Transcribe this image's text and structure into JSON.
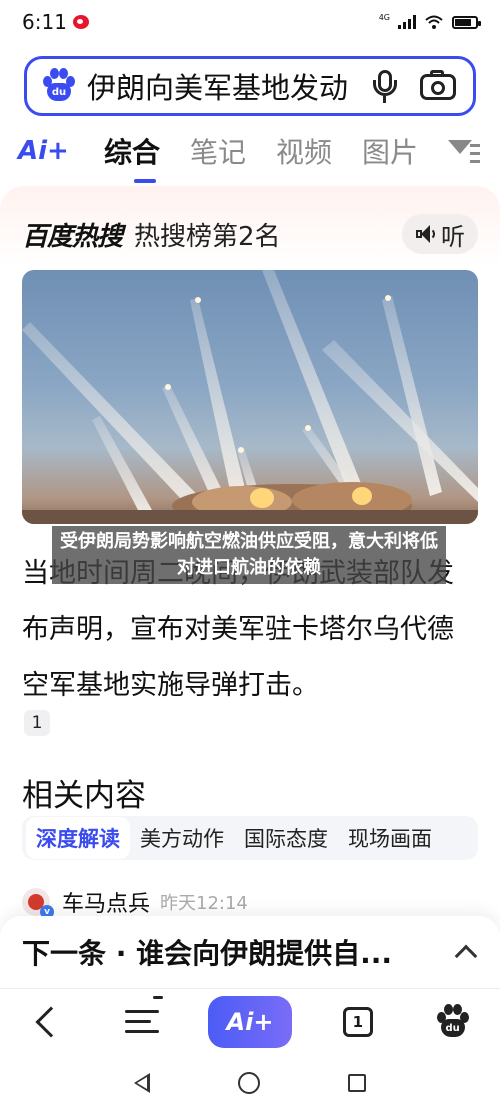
{
  "status": {
    "time": "6:11",
    "network": "4G"
  },
  "search": {
    "query": "伊朗向美军基地发动",
    "logo_text": "du"
  },
  "tabs": {
    "ai_label": "Ai+",
    "items": [
      "综合",
      "笔记",
      "视频",
      "图片"
    ]
  },
  "card": {
    "brand": "百度热搜",
    "rank": "热搜榜第2名",
    "listen_label": "听",
    "image_caption": "受伊朗局势影响航空燃油供应受阻，意大利将低对进口航油的依赖",
    "body": "当地时间周二晚间，伊朗武装部队发布声明，宣布对美军驻卡塔尔乌代德空军基地实施导弹打击。",
    "ref": "1",
    "related_title": "相关内容",
    "chips": [
      "深度解读",
      "美方动作",
      "国际态度",
      "现场画面"
    ],
    "source_name": "车马点兵",
    "source_time": "昨天12:14"
  },
  "next": {
    "text": "下一条 · 谁会向伊朗提供自..."
  },
  "bottom_nav": {
    "ai_label": "Ai+",
    "tab_count": "1",
    "paw_text": "du"
  },
  "colors": {
    "brand_blue": "#3a4cf0",
    "hot_red": "#e8352e",
    "notification_red": "#f0304a"
  }
}
